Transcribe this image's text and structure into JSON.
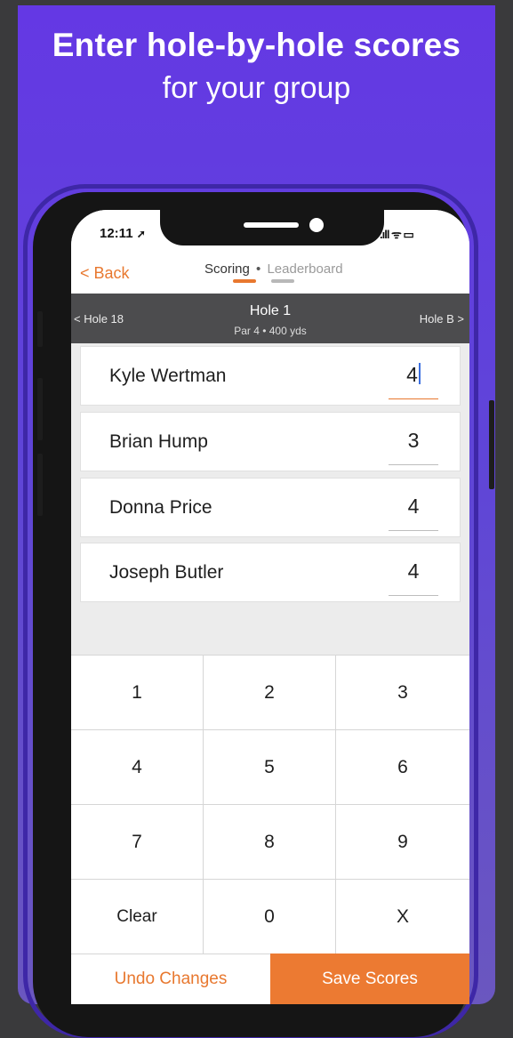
{
  "promo": {
    "headline_line1": "Enter hole-by-hole scores",
    "headline_line2": "for your group"
  },
  "status_bar": {
    "time": "12:11",
    "location_glyph": "➚",
    "signal": ".ıll ᯤ ▭"
  },
  "nav": {
    "back_label": "< Back",
    "tabs": [
      {
        "label": "Scoring",
        "active": true
      },
      {
        "label": "Leaderboard",
        "active": false
      }
    ],
    "tab_separator": "•"
  },
  "hole": {
    "prev_label": "< Hole 18",
    "title": "Hole 1",
    "subtitle": "Par 4 • 400 yds",
    "next_label": "Hole B >"
  },
  "players": [
    {
      "name": "Kyle Wertman",
      "score": "4"
    },
    {
      "name": "Brian Hump",
      "score": "3"
    },
    {
      "name": "Donna Price",
      "score": "4"
    },
    {
      "name": "Joseph Butler",
      "score": "4"
    }
  ],
  "keypad": {
    "keys": [
      "1",
      "2",
      "3",
      "4",
      "5",
      "6",
      "7",
      "8",
      "9",
      "Clear",
      "0",
      "X"
    ]
  },
  "footer": {
    "undo_label": "Undo Changes",
    "save_label": "Save Scores"
  },
  "colors": {
    "accent": "#e8782f",
    "promo_background": "#6438e4",
    "hole_bar": "#4c4c4e"
  }
}
